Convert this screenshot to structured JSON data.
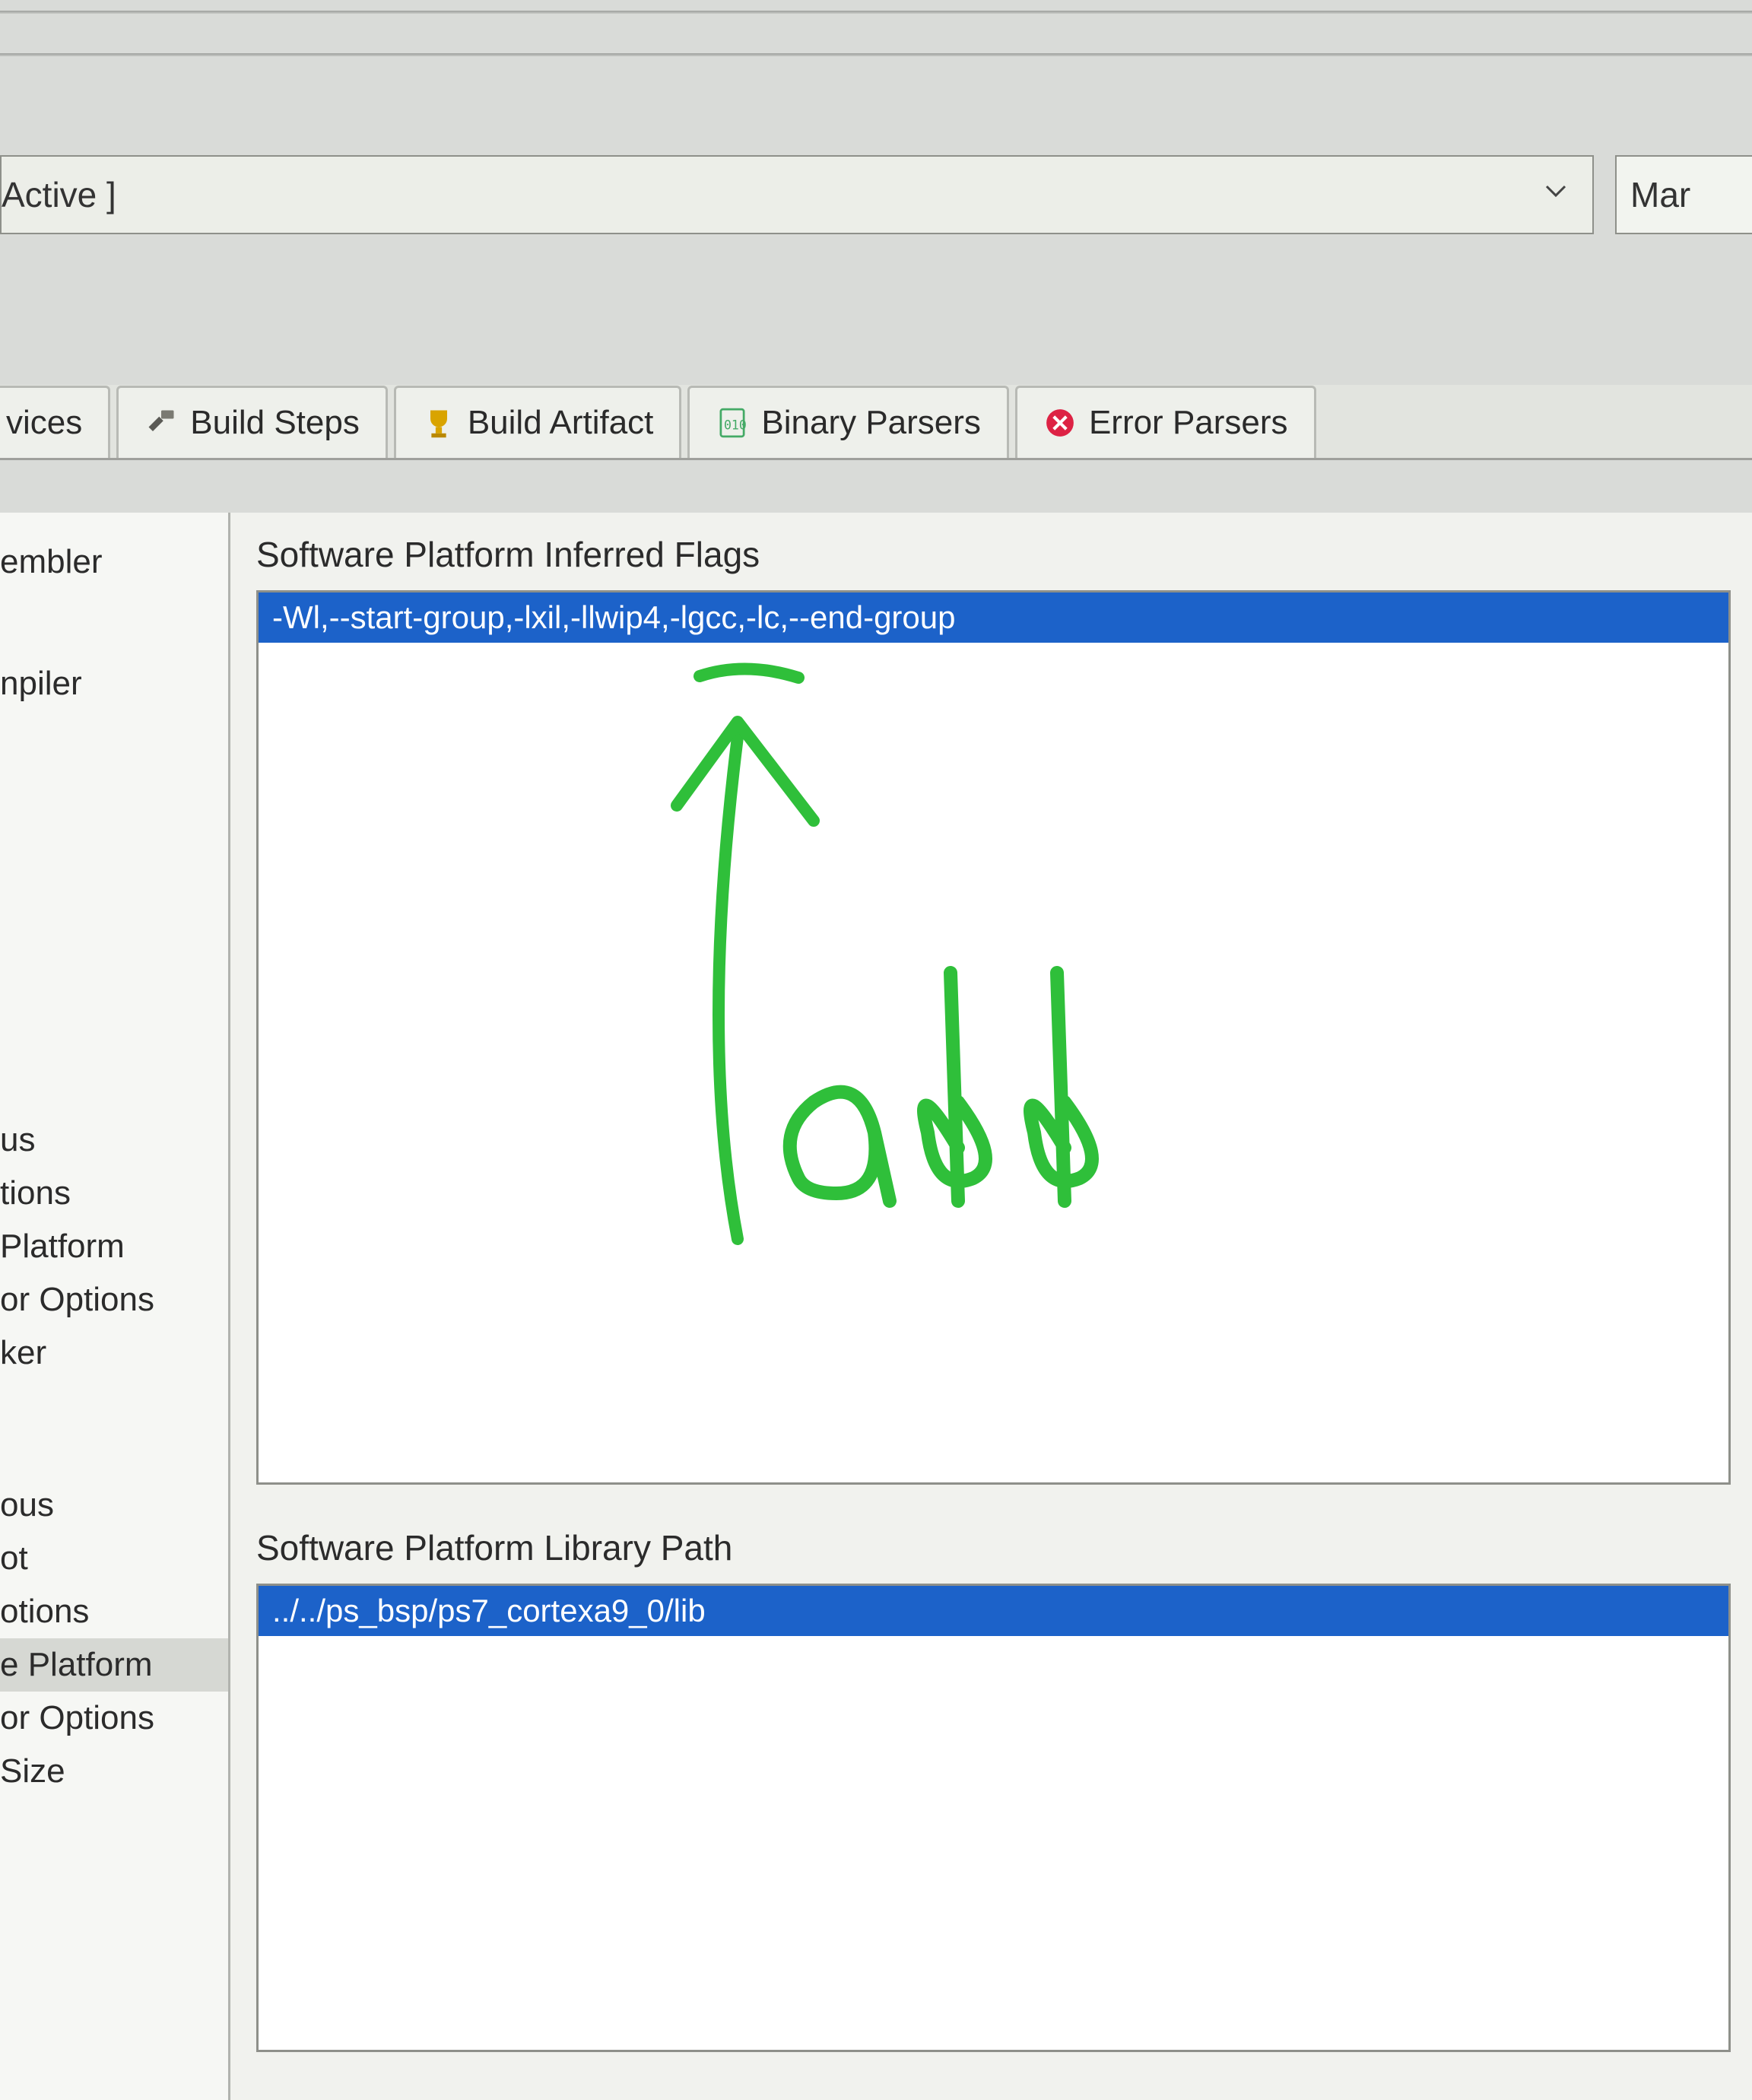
{
  "topbar": {
    "config_label": "Active ]",
    "manage_label": "Mar"
  },
  "tabs": {
    "t0": "vices",
    "t1": "Build Steps",
    "t2": "Build Artifact",
    "t3": "Binary Parsers",
    "t4": "Error Parsers"
  },
  "tree": {
    "n0": "embler",
    "n1": "npiler",
    "n2": "us",
    "n3": "tions",
    "n4": " Platform",
    "n5": "or Options",
    "n6": "ker",
    "n7": "ous",
    "n8": "ot",
    "n9": "otions",
    "n10": "e Platform",
    "n11": "or Options",
    "n12": "Size"
  },
  "panel": {
    "flags_title": "Software Platform Inferred Flags",
    "flags_value": "-Wl,--start-group,-lxil,-llwip4,-lgcc,-lc,--end-group",
    "libpath_title": "Software Platform Library Path",
    "libpath_value": "../../ps_bsp/ps7_cortexa9_0/lib"
  },
  "annotation": {
    "text": "add"
  }
}
